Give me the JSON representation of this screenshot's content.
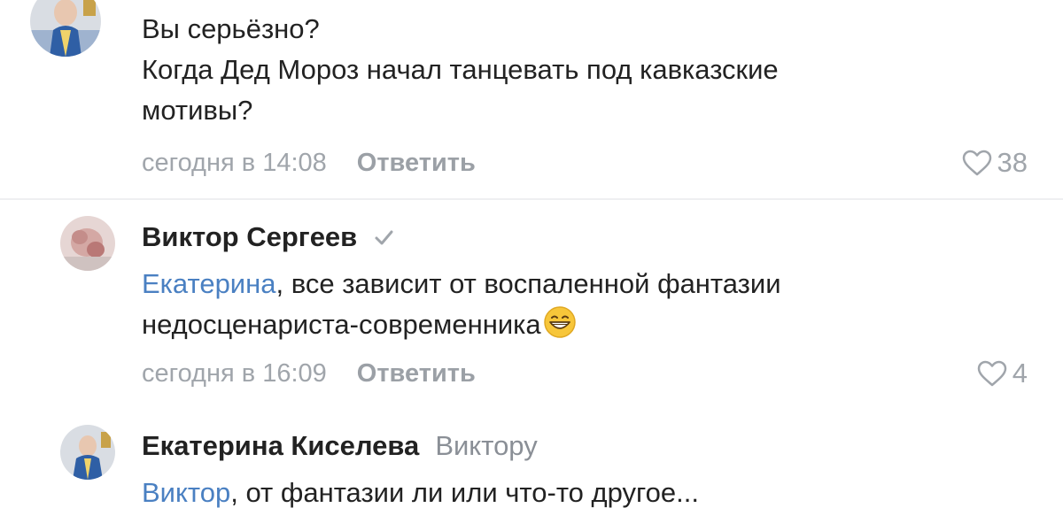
{
  "comments": [
    {
      "text_lines": [
        "Вы серьёзно?",
        "Когда Дед Мороз начал танцевать под кавказские",
        "мотивы?"
      ],
      "timestamp": "сегодня в 14:08",
      "reply_label": "Ответить",
      "likes": "38"
    },
    {
      "author": "Виктор Сергеев",
      "mention": "Екатерина",
      "text_line1_rest": ", все зависит от воспаленной фантазии",
      "text_line2": "недосценариста-современника",
      "timestamp": "сегодня в 16:09",
      "reply_label": "Ответить",
      "likes": "4"
    },
    {
      "author": "Екатерина Киселева",
      "reply_to": "Виктору",
      "mention": "Виктор",
      "text_rest": ", от фантазии ли или что-то другое..."
    }
  ],
  "icons": {
    "verified": "checkmark-icon",
    "like": "heart-icon",
    "emoji": "grinning-face-emoji"
  },
  "colors": {
    "mention": "#4a80c2",
    "meta": "#a0a5ab",
    "text": "#222222"
  }
}
